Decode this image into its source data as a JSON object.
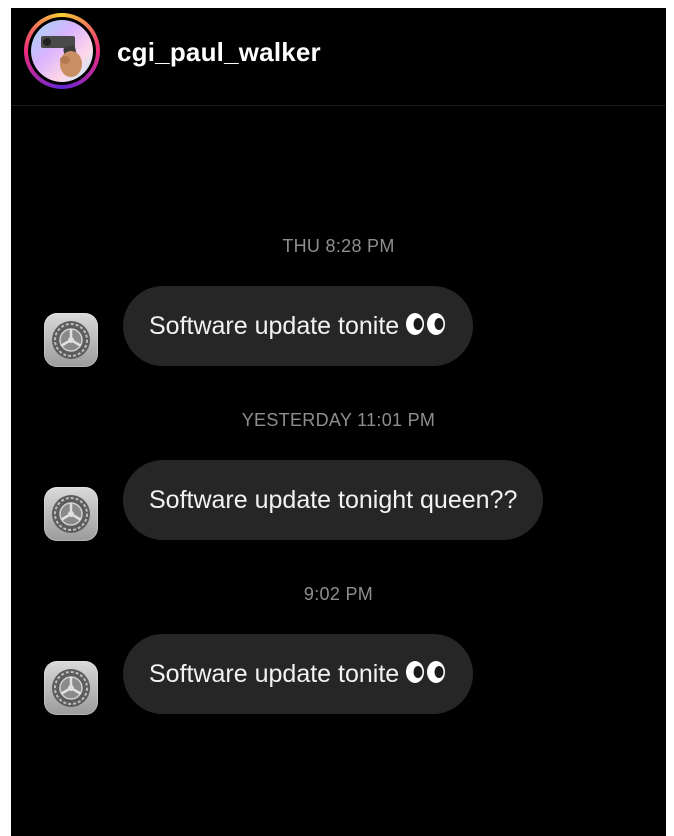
{
  "header": {
    "username": "cgi_paul_walker",
    "avatar_icon": "pistol-avatar-icon"
  },
  "conversation": [
    {
      "timestamp": "THU 8:28 PM",
      "sender_icon": "settings-gear-icon",
      "text": "Software update tonite",
      "emoji": "eyes-emoji"
    },
    {
      "timestamp": "YESTERDAY 11:01 PM",
      "sender_icon": "settings-gear-icon",
      "text": "Software update tonight queen??",
      "emoji": ""
    },
    {
      "timestamp": "9:02 PM",
      "sender_icon": "settings-gear-icon",
      "text": "Software update tonite",
      "emoji": "eyes-emoji"
    }
  ],
  "colors": {
    "background": "#000000",
    "bubble": "#262626",
    "timestamp": "#8e8e8e",
    "text": "#f2f2f2"
  }
}
